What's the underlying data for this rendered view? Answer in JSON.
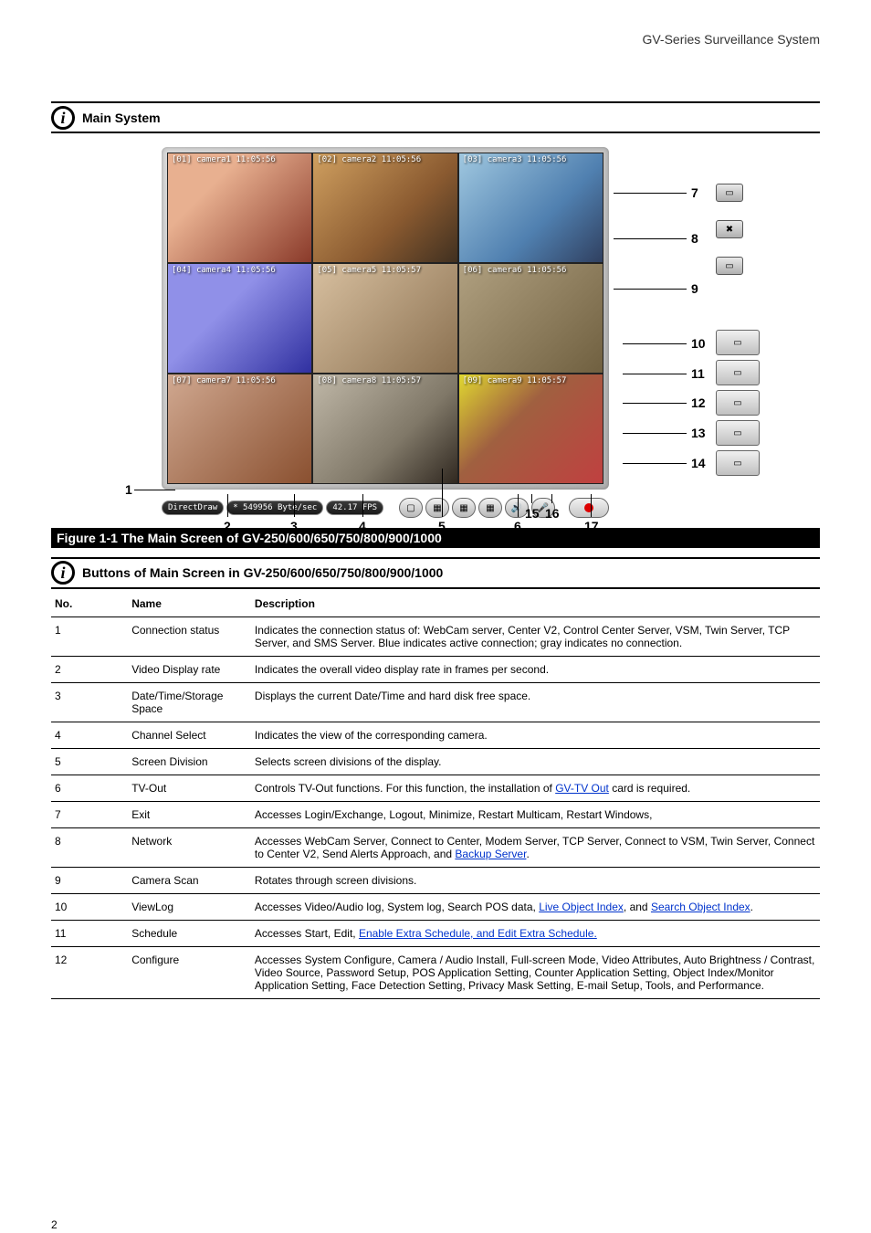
{
  "header": {
    "text": "GV-Series Surveillance System"
  },
  "section1": {
    "title": "Main System",
    "status": {
      "mode": "DirectDraw",
      "rate": "*  549956 Byte/sec",
      "fps": "42.17 FPS"
    },
    "cells": [
      {
        "label": "[01] camera1 11:05:56"
      },
      {
        "label": "[02] camera2 11:05:56"
      },
      {
        "label": "[03] camera3 11:05:56"
      },
      {
        "label": "[04] camera4 11:05:56"
      },
      {
        "label": "[05] camera5 11:05:57"
      },
      {
        "label": "[06] camera6 11:05:56"
      },
      {
        "label": "[07] camera7 11:05:56"
      },
      {
        "label": "[08] camera8 11:05:57"
      },
      {
        "label": "[09] camera9 11:05:57"
      }
    ],
    "callouts": {
      "c1": "1",
      "c2": "2",
      "c3": "3",
      "c4": "4",
      "c5": "5",
      "c6": "6",
      "c7": "7",
      "c8": "8",
      "c9": "9",
      "c10": "10",
      "c11": "11",
      "c12": "12",
      "c13": "13",
      "c14": "14",
      "c15": "15",
      "c16": "16",
      "c17": "17"
    },
    "figure_caption": "Figure 1-1  The Main Screen of GV-250/600/650/750/800/900/1000"
  },
  "section2": {
    "heading": "The Main Screen of GV-250/600/650/750/800/900/1000",
    "title": "Buttons of Main Screen in GV-250/600/650/750/800/900/1000",
    "columns": [
      "No.",
      "Name",
      "Description"
    ],
    "rows": [
      {
        "no": "1",
        "name": "Connection status",
        "desc": "Indicates the connection status of: WebCam server, Center V2, Control Center Server, VSM, Twin Server, TCP Server, and SMS Server. Blue indicates active connection; gray indicates no connection."
      },
      {
        "no": "2",
        "name": "Video Display rate",
        "desc": "Indicates the overall video display rate in frames per second."
      },
      {
        "no": "3",
        "name": "Date/Time/Storage Space",
        "desc": "Displays the current Date/Time and hard disk free space."
      },
      {
        "no": "4",
        "name": "Channel Select",
        "desc": "Indicates the view of the corresponding camera."
      },
      {
        "no": "5",
        "name": "Screen Division",
        "desc": "Selects screen divisions of the display."
      },
      {
        "no": "6",
        "name": "TV-Out",
        "desc": "Controls TV-Out functions. For this function, the installation of GV-TV Out card is required."
      },
      {
        "no": "7",
        "name": "Exit",
        "desc": "Accesses Login/Exchange, Logout, Minimize, Restart Multicam, Restart Windows,"
      },
      {
        "no": "8",
        "name": "Network",
        "desc": "Accesses WebCam Server, Connect to Center, Modem Server, TCP Server, Connect to VSM, Twin Server, Connect to Center V2, Send Alerts Approach, and Backup Server."
      },
      {
        "no": "9",
        "name": "Camera Scan",
        "desc": "Rotates through screen divisions."
      },
      {
        "no": "10",
        "name": "ViewLog",
        "desc": "Accesses Video/Audio log, System log, Search POS data, Live Object Index, and Search Object Index."
      },
      {
        "no": "11",
        "name": "Schedule",
        "desc": "Accesses Start, Edit, Enable Extra Schedule, and Edit Extra Schedule."
      },
      {
        "no": "12",
        "name": "Configure",
        "desc": "Accesses System Configure, Camera / Audio Install, Full-screen Mode, Video Attributes, Auto Brightness / Contrast, Video Source, Password Setup, POS Application Setting, Counter Application Setting, Object Index/Monitor Application Setting, Face Detection Setting, Privacy Mask Setting, E-mail Setup, Tools, and Performance."
      }
    ]
  },
  "footer": {
    "text": "2"
  }
}
